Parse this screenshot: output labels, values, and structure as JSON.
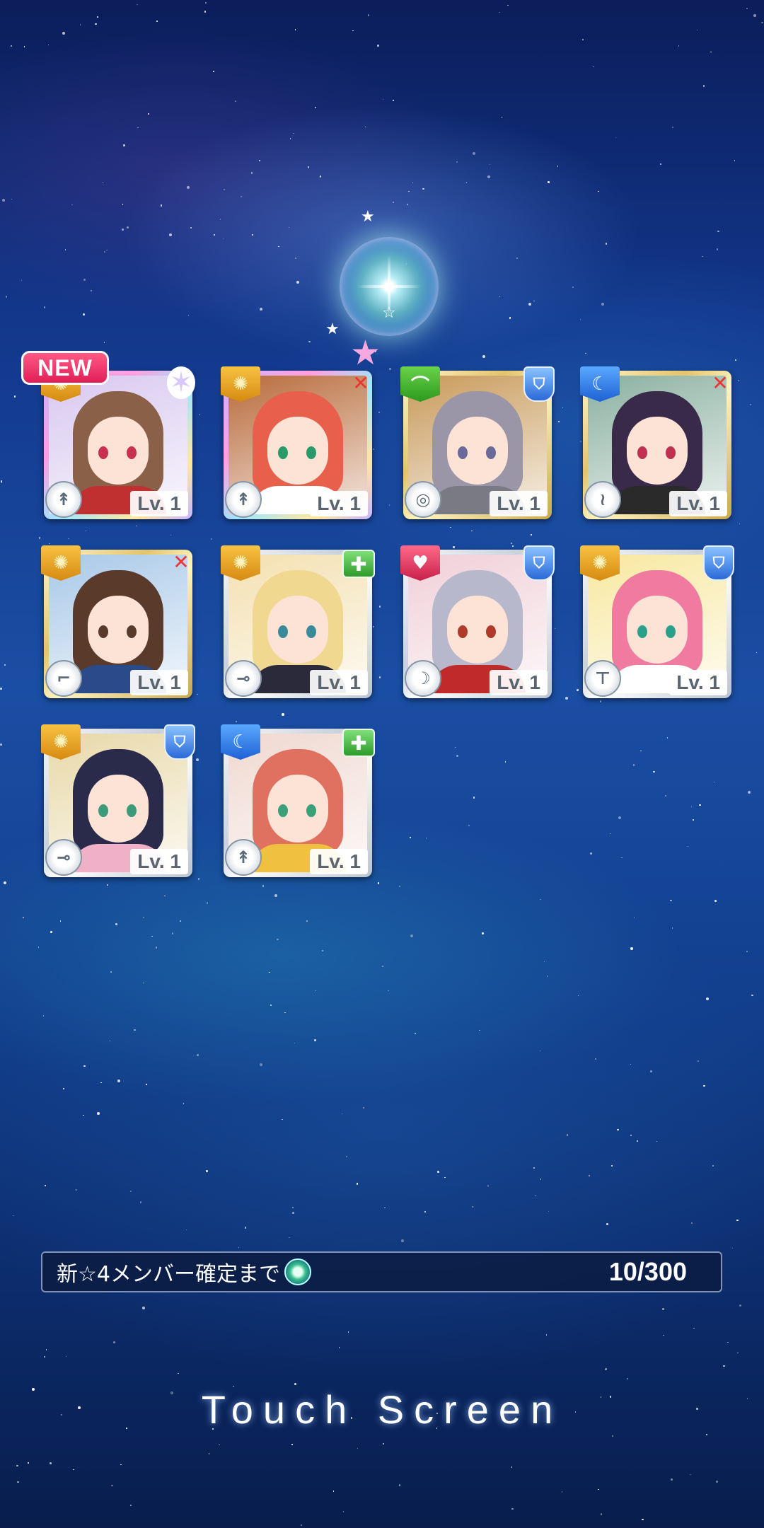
{
  "new_badge": "NEW",
  "cards": [
    {
      "attribute": "sun",
      "attribute_icon": "sun-icon",
      "role": "special",
      "role_icon": "star-icon",
      "weapon_icon": "dagger-icon",
      "level": "Lv. 1",
      "frame": "rainbow",
      "hair": "#8a6048",
      "outfit": "#c03030",
      "bg": "#d8c8f0",
      "eyes": "#c83050"
    },
    {
      "attribute": "sun",
      "attribute_icon": "sun-icon",
      "role": "attacker",
      "role_icon": "sword-icon",
      "weapon_icon": "dagger-icon",
      "level": "Lv. 1",
      "frame": "rainbow",
      "hair": "#e8604c",
      "outfit": "#ffffff",
      "bg": "#b86a3a",
      "eyes": "#2a9a6a"
    },
    {
      "attribute": "leaf",
      "attribute_icon": "leaf-icon",
      "role": "defender",
      "role_icon": "shield-icon",
      "weapon_icon": "shield-ring-icon",
      "level": "Lv. 1",
      "frame": "gold",
      "hair": "#9a96a8",
      "outfit": "#7a7a84",
      "bg": "#c89a5a",
      "eyes": "#6a6a9a"
    },
    {
      "attribute": "moon",
      "attribute_icon": "moon-icon",
      "role": "attacker",
      "role_icon": "sword-icon",
      "weapon_icon": "claw-icon",
      "level": "Lv. 1",
      "frame": "gold",
      "hair": "#3a2a4a",
      "outfit": "#2a2a2a",
      "bg": "#8ab0a0",
      "eyes": "#c03050"
    },
    {
      "attribute": "sun",
      "attribute_icon": "sun-icon",
      "role": "attacker",
      "role_icon": "sword-icon",
      "weapon_icon": "gun-icon",
      "level": "Lv. 1",
      "frame": "gold",
      "hair": "#5a3a2a",
      "outfit": "#2a4a8a",
      "bg": "#a8c8e8",
      "eyes": "#5a3a2a"
    },
    {
      "attribute": "sun",
      "attribute_icon": "sun-icon",
      "role": "healer",
      "role_icon": "medkit-icon",
      "weapon_icon": "rifle-icon",
      "level": "Lv. 1",
      "frame": "silver",
      "hair": "#f0d890",
      "outfit": "#2a2a3a",
      "bg": "#f4e0b0",
      "eyes": "#3a8a9a"
    },
    {
      "attribute": "heart",
      "attribute_icon": "heart-icon",
      "role": "defender",
      "role_icon": "shield-icon",
      "weapon_icon": "bow-icon",
      "level": "Lv. 1",
      "frame": "silver",
      "hair": "#b8b8cc",
      "outfit": "#c02a2a",
      "bg": "#f0d0d8",
      "eyes": "#b03a2a"
    },
    {
      "attribute": "sun",
      "attribute_icon": "sun-icon",
      "role": "defender",
      "role_icon": "shield-icon",
      "weapon_icon": "hammer-icon",
      "level": "Lv. 1",
      "frame": "silver",
      "hair": "#f07aa0",
      "outfit": "#ffffff",
      "bg": "#f8e8a0",
      "eyes": "#2aa08a"
    },
    {
      "attribute": "sun",
      "attribute_icon": "sun-icon",
      "role": "defender",
      "role_icon": "shield-icon",
      "weapon_icon": "rifle-icon",
      "level": "Lv. 1",
      "frame": "silver",
      "hair": "#2a2a4a",
      "outfit": "#f0b0c8",
      "bg": "#e8d8a8",
      "eyes": "#3a9a7a"
    },
    {
      "attribute": "moon",
      "attribute_icon": "moon-icon",
      "role": "healer",
      "role_icon": "medkit-icon",
      "weapon_icon": "dagger-icon",
      "level": "Lv. 1",
      "frame": "silver",
      "hair": "#e07060",
      "outfit": "#f0c040",
      "bg": "#f0d8d0",
      "eyes": "#3aa07a"
    }
  ],
  "progress": {
    "label": "新☆4メンバー確定まで",
    "icon": "gem-icon",
    "count": "10/300"
  },
  "touch_text": "Touch Screen"
}
